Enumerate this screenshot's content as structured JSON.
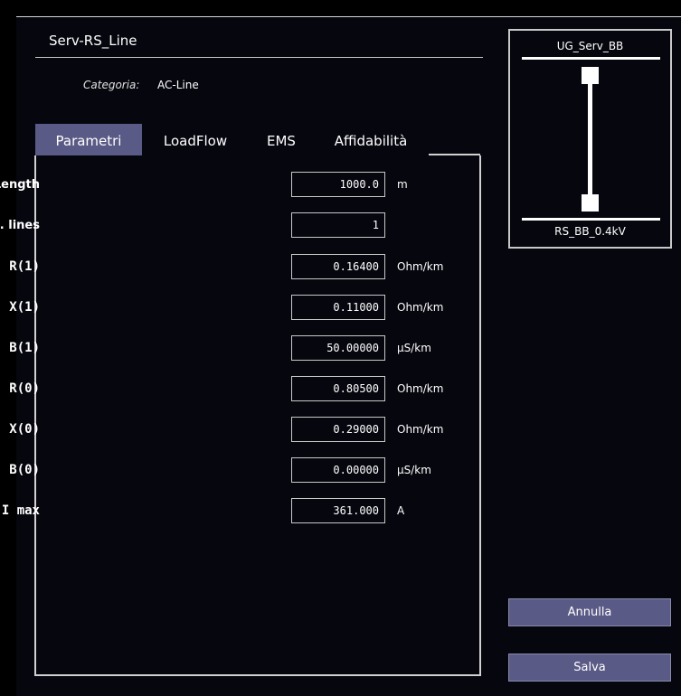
{
  "header": {
    "title": "Serv-RS_Line",
    "categoria_label": "Categoria:",
    "categoria_value": "AC-Line"
  },
  "tabs": [
    {
      "label": "Parametri",
      "active": true
    },
    {
      "label": "LoadFlow",
      "active": false
    },
    {
      "label": "EMS",
      "active": false
    },
    {
      "label": "Affidabilità",
      "active": false
    }
  ],
  "params": [
    {
      "label": "Length",
      "value": "1000.0",
      "unit": "m"
    },
    {
      "label": "N. lines",
      "value": "1",
      "unit": ""
    },
    {
      "label": "R(1)",
      "value": "0.16400",
      "unit": "Ohm/km"
    },
    {
      "label": "X(1)",
      "value": "0.11000",
      "unit": "Ohm/km"
    },
    {
      "label": "B(1)",
      "value": "50.00000",
      "unit": "µS/km"
    },
    {
      "label": "R(0)",
      "value": "0.80500",
      "unit": "Ohm/km"
    },
    {
      "label": "X(0)",
      "value": "0.29000",
      "unit": "Ohm/km"
    },
    {
      "label": "B(0)",
      "value": "0.00000",
      "unit": "µS/km"
    },
    {
      "label": "I max",
      "value": "361.000",
      "unit": "A"
    }
  ],
  "diagram": {
    "top_bus": "UG_Serv_BB",
    "bottom_bus": "RS_BB_0.4kV"
  },
  "buttons": {
    "cancel": "Annulla",
    "save": "Salva"
  },
  "colors": {
    "background": "#06060f",
    "accent": "#5a5a86",
    "border": "#c8c8c8"
  }
}
